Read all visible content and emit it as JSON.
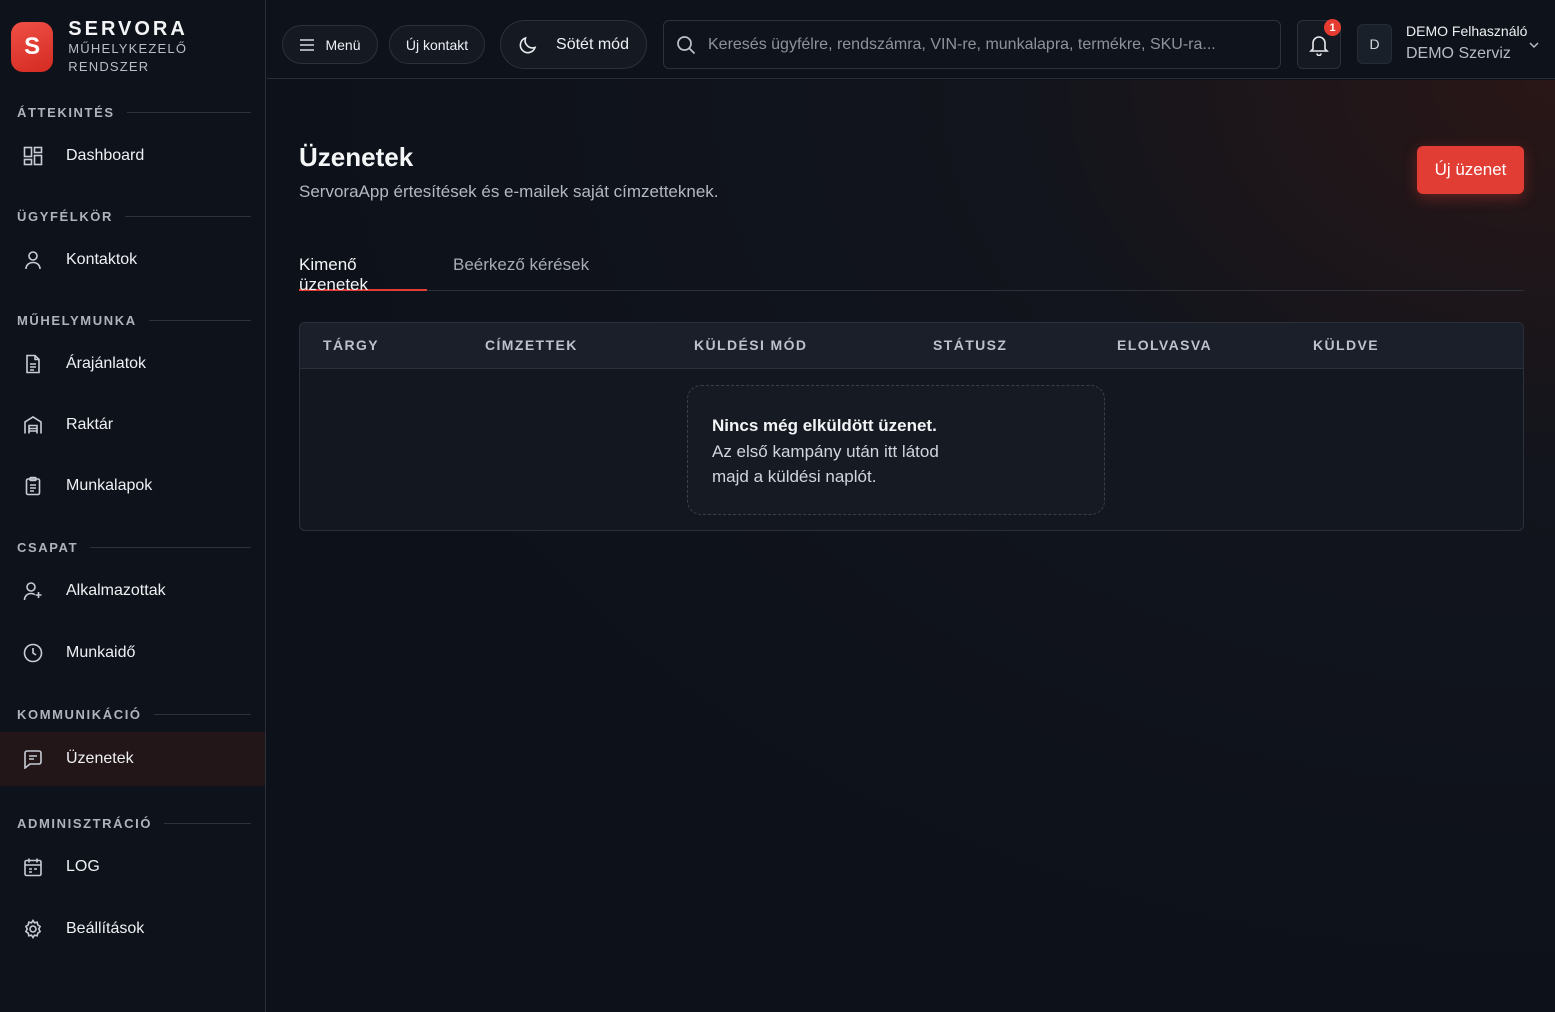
{
  "brand": {
    "logo_letter": "S",
    "name": "SERVORA",
    "subtitle": "MŰHELYKEZELŐ RENDSZER"
  },
  "sidebar": {
    "sections": {
      "overview": "ÁTTEKINTÉS",
      "customers": "ÜGYFÉLKÖR",
      "workshop": "MŰHELYMUNKA",
      "team": "CSAPAT",
      "communication": "KOMMUNIKÁCIÓ",
      "admin": "ADMINISZTRÁCIÓ"
    },
    "items": {
      "dashboard": "Dashboard",
      "contacts": "Kontaktok",
      "quotes": "Árajánlatok",
      "warehouse": "Raktár",
      "worksheets": "Munkalapok",
      "employees": "Alkalmazottak",
      "worktime": "Munkaidő",
      "messages": "Üzenetek",
      "log": "LOG",
      "settings": "Beállítások"
    },
    "active_item": "messages"
  },
  "topbar": {
    "menu_label": "Menü",
    "new_contact_label": "Új kontakt",
    "dark_mode_label": "Sötét mód",
    "search_placeholder": "Keresés ügyfélre, rendszámra, VIN-re, munkalapra, termékre, SKU-ra...",
    "notification_count": "1",
    "avatar_letter": "D",
    "user_name": "DEMO Felhasználó",
    "user_org": "DEMO Szerviz"
  },
  "page": {
    "title": "Üzenetek",
    "subtitle": "ServoraApp értesítések és e-mailek saját címzetteknek.",
    "new_message_label": "Új üzenet",
    "tabs": [
      "Kimenő üzenetek",
      "Beérkező kérések"
    ],
    "active_tab": 0,
    "table": {
      "columns": [
        "TÁRGY",
        "CÍMZETTEK",
        "KÜLDÉSI MÓD",
        "STÁTUSZ",
        "ELOLVASVA",
        "KÜLDVE"
      ],
      "rows": [],
      "empty_title": "Nincs még elküldött üzenet.",
      "empty_text": "Az első kampány után itt látod majd a küldési naplót."
    }
  },
  "colors": {
    "accent": "#e13d34",
    "background": "#0d1119",
    "sidebar_bg": "#0e121a",
    "active_nav_bg": "#221619"
  }
}
